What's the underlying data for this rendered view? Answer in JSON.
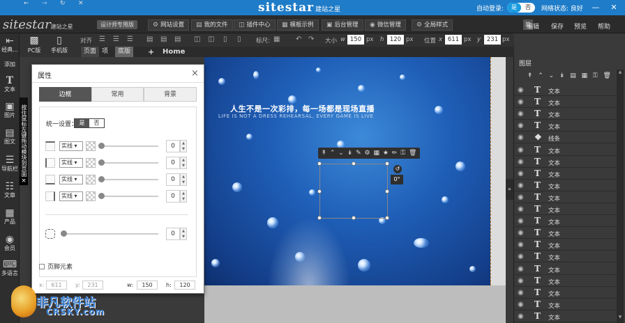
{
  "topbar": {
    "brand": "sitestar",
    "brand_sub": "建站之星",
    "autologin_label": "自动登录:",
    "toggle_on": "是",
    "toggle_off": "否",
    "network_status": "网络状态: 良好",
    "colors": {
      "bar": "#1f7cc8",
      "accent": "#1a9be0"
    }
  },
  "menubar": {
    "logo": "sitestar",
    "logo_sub": "建站之星",
    "designer": "设计师专用版",
    "items": [
      {
        "label": "网站设置",
        "icon": "gear-icon"
      },
      {
        "label": "我的文件",
        "icon": "folder-icon"
      },
      {
        "label": "插件中心",
        "icon": "plugin-icon"
      },
      {
        "label": "模板示例",
        "icon": "template-icon"
      },
      {
        "label": "后台管理",
        "icon": "admin-icon"
      },
      {
        "label": "微信管理",
        "icon": "wechat-icon"
      },
      {
        "label": "全局样式",
        "icon": "gear-icon"
      }
    ],
    "lang": "简",
    "right_items": [
      "编辑",
      "保存",
      "预览",
      "帮助"
    ]
  },
  "toolbar": {
    "align_label": "对齐",
    "label_label": "标尺:",
    "size_label": "大小",
    "w_label": "w",
    "w_value": "150",
    "h_label": "h",
    "h_value": "120",
    "unit": "px",
    "pos_label": "位置",
    "x_label": "x",
    "x_value": "611",
    "y_label": "y",
    "y_value": "231"
  },
  "devices": [
    {
      "label": "PC版",
      "icon": "monitor-icon"
    },
    {
      "label": "手机版",
      "icon": "phone-icon"
    }
  ],
  "pagebar": {
    "tabs": [
      "页面",
      "项",
      "底版"
    ],
    "add": "+",
    "home": "Home"
  },
  "leftcol": {
    "exit": "经典...",
    "add": "添加",
    "items": [
      {
        "label": "文本",
        "icon": "text-icon"
      },
      {
        "label": "图片",
        "icon": "image-icon"
      },
      {
        "label": "图文",
        "icon": "image-text-icon"
      },
      {
        "label": "导航栏",
        "icon": "nav-icon"
      },
      {
        "label": "文章",
        "icon": "article-icon"
      },
      {
        "label": "产品",
        "icon": "product-icon"
      },
      {
        "label": "会员",
        "icon": "member-icon"
      },
      {
        "label": "多语言",
        "icon": "keyboard-icon"
      }
    ]
  },
  "tip": {
    "text": "按住鼠标左键拖动模块到页面",
    "close": "×"
  },
  "hero": {
    "title": "人生不是一次彩排，每一场都是现场直播",
    "subtitle": "LIFE IS NOT A DRESS REHEARSAL, EVERY GAME IS LIVE"
  },
  "selection": {
    "rotation": "0°"
  },
  "panel": {
    "title": "属性",
    "close": "×",
    "tabs": [
      "边框",
      "常用",
      "背景"
    ],
    "active_tab": 0,
    "unify_label": "统一设置：",
    "unify_on": "是",
    "unify_off": "否",
    "border_rows": [
      {
        "style": "实线",
        "value": "0"
      },
      {
        "style": "实线",
        "value": "0"
      },
      {
        "style": "实线",
        "value": "0"
      },
      {
        "style": "实线",
        "value": "0"
      }
    ],
    "radius_value": "0",
    "footer_checkbox": "页脚元素",
    "coords": {
      "x_label": "x:",
      "x": "611",
      "y_label": "y:",
      "y": "231",
      "w_label": "w:",
      "w": "150",
      "h_label": "h:",
      "h": "120"
    }
  },
  "layers": {
    "title": "图层",
    "items": [
      {
        "name": "文本",
        "icon": "text-icon"
      },
      {
        "name": "文本",
        "icon": "text-icon"
      },
      {
        "name": "文本",
        "icon": "text-icon"
      },
      {
        "name": "文本",
        "icon": "text-icon"
      },
      {
        "name": "线条",
        "icon": "line-icon"
      },
      {
        "name": "文本",
        "icon": "text-icon"
      },
      {
        "name": "文本",
        "icon": "text-icon"
      },
      {
        "name": "文本",
        "icon": "text-icon"
      },
      {
        "name": "文本",
        "icon": "text-icon"
      },
      {
        "name": "文本",
        "icon": "text-icon"
      },
      {
        "name": "文本",
        "icon": "text-icon"
      },
      {
        "name": "文本",
        "icon": "text-icon"
      },
      {
        "name": "文本",
        "icon": "text-icon"
      },
      {
        "name": "文本",
        "icon": "text-icon"
      },
      {
        "name": "文本",
        "icon": "text-icon"
      },
      {
        "name": "文本",
        "icon": "text-icon"
      },
      {
        "name": "文本",
        "icon": "text-icon"
      },
      {
        "name": "文本",
        "icon": "text-icon"
      },
      {
        "name": "文本",
        "icon": "text-icon"
      },
      {
        "name": "文本",
        "icon": "text-icon"
      }
    ]
  },
  "watermark": {
    "cn": "非凡软件站",
    "en": "CRSKY.com"
  }
}
